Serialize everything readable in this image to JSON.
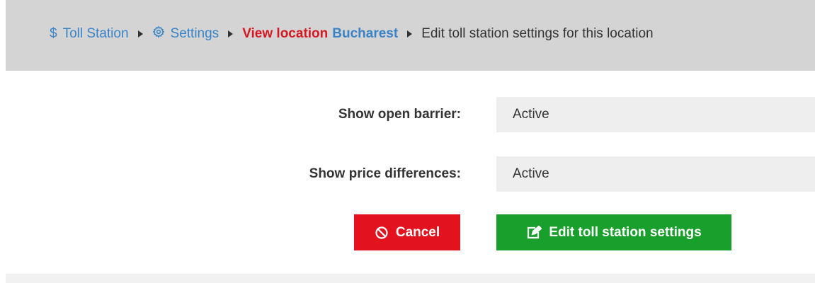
{
  "breadcrumb": {
    "home_label": "Toll Station",
    "home_icon": "dollar-icon",
    "settings_label": "Settings",
    "settings_icon": "gear-icon",
    "view_prefix": "View location",
    "view_location": "Bucharest",
    "current": "Edit toll station settings for this location"
  },
  "form": {
    "rows": [
      {
        "label": "Show open barrier:",
        "value": "Active"
      },
      {
        "label": "Show price differences:",
        "value": "Active"
      }
    ]
  },
  "actions": {
    "cancel_label": "Cancel",
    "cancel_icon": "ban-icon",
    "edit_label": "Edit toll station settings",
    "edit_icon": "edit-icon"
  },
  "colors": {
    "link": "#3a84c6",
    "danger": "#e2131e",
    "success": "#19a02c",
    "header_bg": "#d4d4d4"
  }
}
